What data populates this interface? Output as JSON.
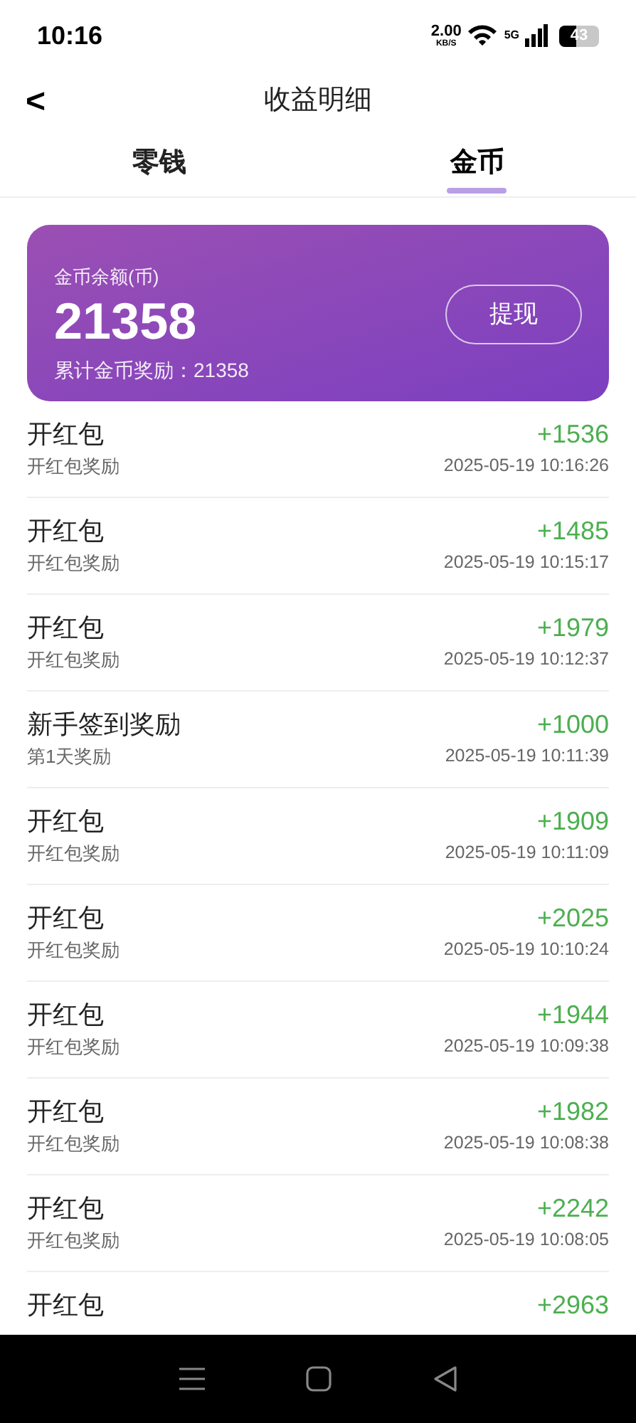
{
  "status_bar": {
    "time": "10:16",
    "net_speed": "2.00",
    "net_unit": "KB/S",
    "network": "5G",
    "battery": "43"
  },
  "header": {
    "back": "<",
    "title": "收益明细"
  },
  "tabs": [
    {
      "label": "零钱",
      "selected": false
    },
    {
      "label": "金币",
      "selected": true
    }
  ],
  "balance_card": {
    "label": "金币余额(币)",
    "amount": "21358",
    "total": "累计金币奖励：21358",
    "button": "提现"
  },
  "records": [
    {
      "title": "开红包",
      "subtitle": "开红包奖励",
      "amount": "+1536",
      "time": "2025-05-19 10:16:26"
    },
    {
      "title": "开红包",
      "subtitle": "开红包奖励",
      "amount": "+1485",
      "time": "2025-05-19 10:15:17"
    },
    {
      "title": "开红包",
      "subtitle": "开红包奖励",
      "amount": "+1979",
      "time": "2025-05-19 10:12:37"
    },
    {
      "title": "新手签到奖励",
      "subtitle": "第1天奖励",
      "amount": "+1000",
      "time": "2025-05-19 10:11:39"
    },
    {
      "title": "开红包",
      "subtitle": "开红包奖励",
      "amount": "+1909",
      "time": "2025-05-19 10:11:09"
    },
    {
      "title": "开红包",
      "subtitle": "开红包奖励",
      "amount": "+2025",
      "time": "2025-05-19 10:10:24"
    },
    {
      "title": "开红包",
      "subtitle": "开红包奖励",
      "amount": "+1944",
      "time": "2025-05-19 10:09:38"
    },
    {
      "title": "开红包",
      "subtitle": "开红包奖励",
      "amount": "+1982",
      "time": "2025-05-19 10:08:38"
    },
    {
      "title": "开红包",
      "subtitle": "开红包奖励",
      "amount": "+2242",
      "time": "2025-05-19 10:08:05"
    },
    {
      "title": "开红包",
      "amount": "+2963"
    }
  ]
}
